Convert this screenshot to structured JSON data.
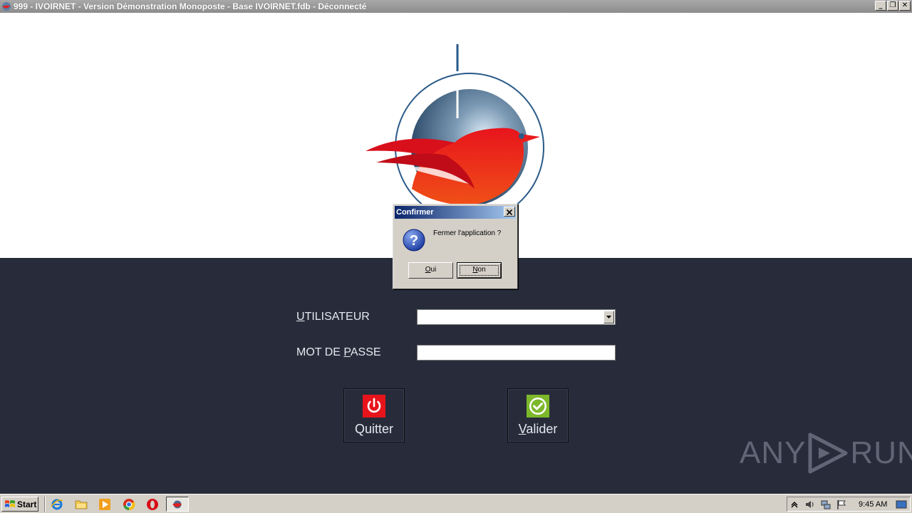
{
  "window": {
    "title": "999 - IVOIRNET - Version Démonstration Monoposte - Base IVOIRNET.fdb - Déconnecté",
    "min_label": "_",
    "restore_label": "❐",
    "close_label": "✕"
  },
  "login": {
    "user_label_first": "U",
    "user_label_rest": "TILISATEUR",
    "pass_label_first": "MOT DE ",
    "pass_label_u": "P",
    "pass_label_rest": "ASSE",
    "user_value": "",
    "pass_value": ""
  },
  "buttons": {
    "quit_label": "Quitter",
    "valid_first": "V",
    "valid_rest": "alider"
  },
  "dialog": {
    "title": "Confirmer",
    "message": "Fermer l'application ?",
    "yes_first": "O",
    "yes_rest": "ui",
    "no_first": "N",
    "no_rest": "on"
  },
  "watermark": {
    "left": "ANY",
    "right": "RUN"
  },
  "taskbar": {
    "start_label": "Start",
    "clock": "9:45 AM"
  },
  "colors": {
    "dark_bg": "#282c3a",
    "quit_red": "#e8141c",
    "valid_green": "#7cb82a"
  }
}
